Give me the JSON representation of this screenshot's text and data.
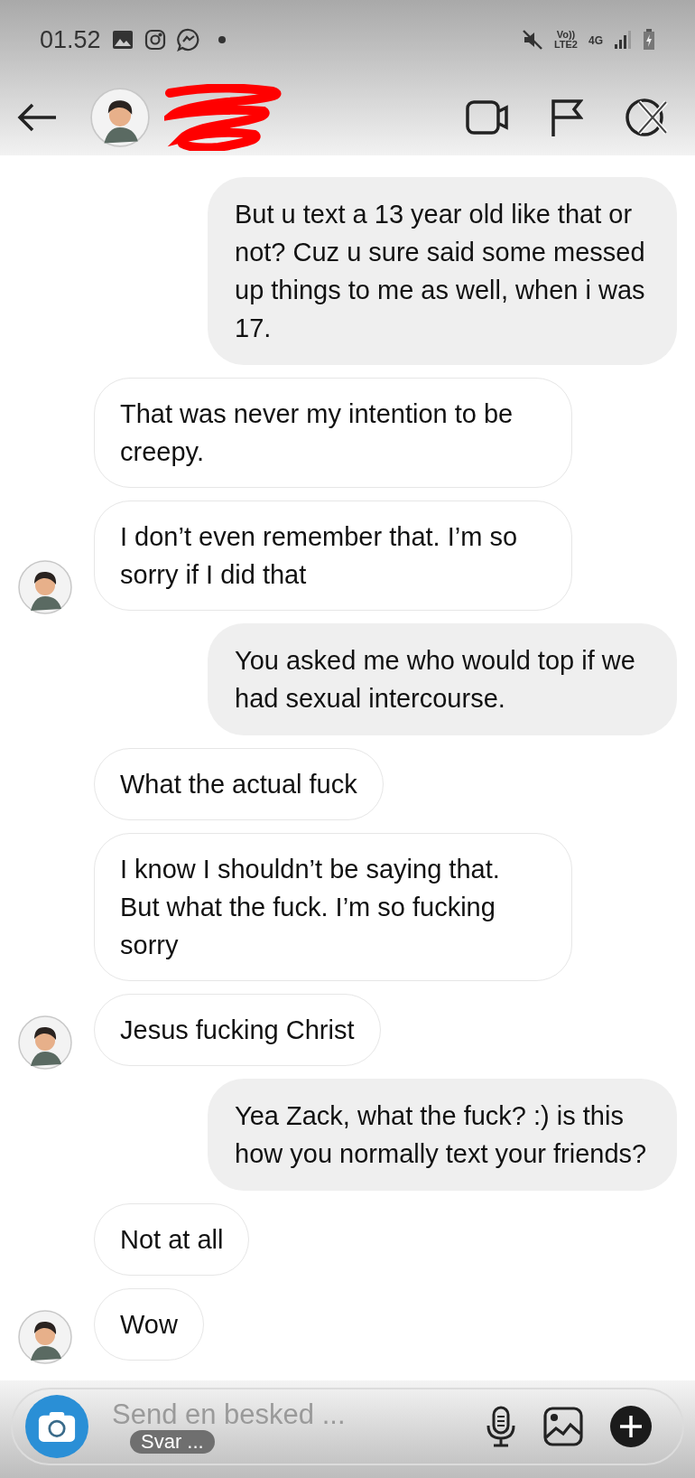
{
  "status_bar": {
    "time": "01.52",
    "volte": "Vo))",
    "network": "LTE2",
    "generation": "4G"
  },
  "messages": [
    {
      "kind": "sent",
      "text": "But u text a 13 year old like that or not? Cuz u sure said some messed up things to me as well, when i was 17.",
      "avatar": false
    },
    {
      "kind": "received",
      "text": "That was never my intention to be creepy.",
      "avatar": false
    },
    {
      "kind": "received",
      "text": "I don’t even remember that. I’m so sorry if I did that",
      "avatar": true
    },
    {
      "kind": "sent",
      "text": "You asked me who would top if we had sexual intercourse.",
      "avatar": false
    },
    {
      "kind": "received",
      "text": "What the actual fuck",
      "avatar": false
    },
    {
      "kind": "received",
      "text": "I know I shouldn’t be saying that. But what the fuck. I’m so fucking sorry",
      "avatar": false
    },
    {
      "kind": "received",
      "text": "Jesus fucking Christ",
      "avatar": true
    },
    {
      "kind": "sent",
      "text": "Yea Zack, what the fuck? :) is this how you normally text your friends?",
      "avatar": false
    },
    {
      "kind": "received",
      "text": "Not at all",
      "avatar": false
    },
    {
      "kind": "received",
      "text": "Wow",
      "avatar": true
    }
  ],
  "composer": {
    "placeholder": "Send en besked ...",
    "reply_hint": "Svar ..."
  }
}
